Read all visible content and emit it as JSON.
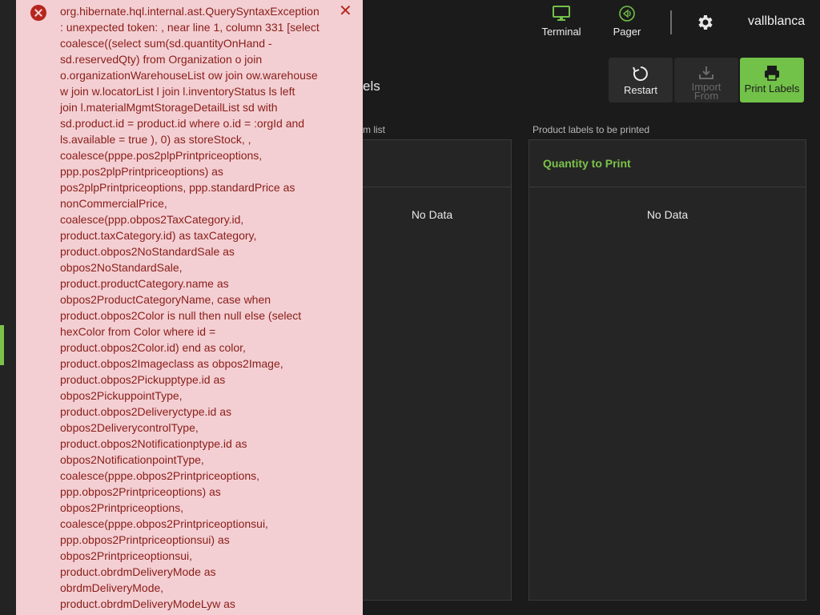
{
  "header": {
    "terminal_label": "Terminal",
    "pager_label": "Pager",
    "user_name": "vallblanca"
  },
  "page": {
    "title_fragment": "els"
  },
  "actions": {
    "restart_label": "Restart",
    "import_label_line1": "Import",
    "import_label_line2": "From",
    "print_label": "Print Labels"
  },
  "left_panel": {
    "caption_fragment": "m list",
    "empty_text": "No Data"
  },
  "right_panel": {
    "caption": "Product labels to be printed",
    "column_header": "Quantity to Print",
    "empty_text": "No Data"
  },
  "error_toast": {
    "message": "org.hibernate.hql.internal.ast.QuerySyntaxException\n: unexpected token: , near line 1, column 331 [select\ncoalesce((select sum(sd.quantityOnHand -\nsd.reservedQty) from Organization o join\no.organizationWarehouseList ow join ow.warehouse\nw join w.locatorList l join l.inventoryStatus ls left\njoin l.materialMgmtStorageDetailList sd with\nsd.product.id = product.id where o.id = :orgId and\nls.available = true ), 0) as storeStock, ,\ncoalesce(pppe.pos2plpPrintpriceoptions,\nppp.pos2plpPrintpriceoptions) as\npos2plpPrintpriceoptions, ppp.standardPrice as\nnonCommercialPrice,\ncoalesce(ppp.obpos2TaxCategory.id,\nproduct.taxCategory.id) as taxCategory,\nproduct.obpos2NoStandardSale as\nobpos2NoStandardSale,\nproduct.productCategory.name as\nobpos2ProductCategoryName, case when\nproduct.obpos2Color is null then null else (select\nhexColor from Color where id =\nproduct.obpos2Color.id) end as color,\nproduct.obpos2Imageclass as obpos2Image,\nproduct.obpos2Pickupptype.id as\nobpos2PickuppointType,\nproduct.obpos2Deliveryctype.id as\nobpos2DeliverycontrolType,\nproduct.obpos2Notificationptype.id as\nobpos2NotificationpointType,\ncoalesce(pppe.obpos2Printpriceoptions,\nppp.obpos2Printpriceoptions) as\nobpos2Printpriceoptions,\ncoalesce(pppe.obpos2Printpriceoptionsui,\nppp.obpos2Printpriceoptionsui) as\nobpos2Printpriceoptionsui,\nproduct.obrdmDeliveryMode as\nobrdmDeliveryMode,\nproduct.obrdmDeliveryModeLyw as"
  },
  "colors": {
    "accent": "#72c149",
    "error_bg": "#f3cfd3",
    "error_text": "#8a1d18",
    "background": "#1b1b1b"
  }
}
